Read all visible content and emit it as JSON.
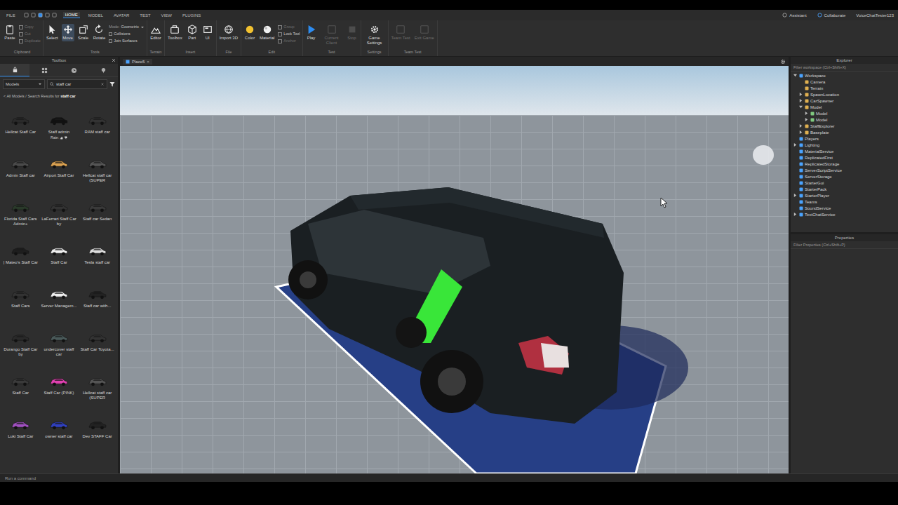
{
  "menu_bar": {
    "items": [
      {
        "label": "FILE",
        "selected": false
      },
      {
        "label": "HOME",
        "selected": true
      },
      {
        "label": "MODEL",
        "selected": false
      },
      {
        "label": "AVATAR",
        "selected": false
      },
      {
        "label": "TEST",
        "selected": false
      },
      {
        "label": "VIEW",
        "selected": false
      },
      {
        "label": "PLUGINS",
        "selected": false
      }
    ],
    "right": [
      {
        "label": "Assistant"
      },
      {
        "label": "Collaborate"
      },
      {
        "label": "VoiceChatTester123"
      }
    ]
  },
  "ribbon": {
    "groups": [
      {
        "label": "Clipboard",
        "buttons": [
          {
            "label": "Paste",
            "kind": "large",
            "disabled": false,
            "selected": false
          },
          {
            "label": "Copy",
            "kind": "small",
            "disabled": true,
            "selected": false
          },
          {
            "label": "Cut",
            "kind": "small",
            "disabled": true,
            "selected": false
          },
          {
            "label": "Duplicate",
            "kind": "small",
            "disabled": true,
            "selected": false
          }
        ]
      },
      {
        "label": "Tools",
        "buttons": [
          {
            "label": "Select",
            "kind": "large",
            "disabled": false,
            "selected": false
          },
          {
            "label": "Move",
            "kind": "large",
            "disabled": false,
            "selected": true
          },
          {
            "label": "Scale",
            "kind": "large",
            "disabled": false,
            "selected": false
          },
          {
            "label": "Rotate",
            "kind": "large",
            "disabled": false,
            "selected": false
          },
          {
            "label": "Mode:",
            "value": "Geometric",
            "kind": "dropdown",
            "disabled": false,
            "selected": false
          },
          {
            "label": "Collisions",
            "kind": "check",
            "checked": false,
            "disabled": false,
            "selected": false
          },
          {
            "label": "Join Surfaces",
            "kind": "check",
            "checked": false,
            "disabled": false,
            "selected": false
          }
        ]
      },
      {
        "label": "Terrain",
        "buttons": [
          {
            "label": "Editor",
            "kind": "large",
            "disabled": false,
            "selected": false
          }
        ]
      },
      {
        "label": "Insert",
        "buttons": [
          {
            "label": "Toolbox",
            "kind": "large",
            "disabled": false,
            "selected": false
          },
          {
            "label": "Part",
            "kind": "large",
            "disabled": false,
            "selected": false
          },
          {
            "label": "UI",
            "kind": "large",
            "disabled": false,
            "selected": false
          }
        ]
      },
      {
        "label": "File",
        "buttons": [
          {
            "label": "Import 3D",
            "kind": "large",
            "disabled": false,
            "selected": false
          }
        ]
      },
      {
        "label": "Edit",
        "buttons": [
          {
            "label": "Color",
            "kind": "large",
            "disabled": false,
            "selected": false
          },
          {
            "label": "Material",
            "kind": "large",
            "disabled": false,
            "selected": false
          },
          {
            "label": "Group",
            "kind": "small",
            "disabled": true,
            "selected": false
          },
          {
            "label": "Lock Tool",
            "kind": "small",
            "disabled": false,
            "selected": false
          },
          {
            "label": "Anchor",
            "kind": "small",
            "disabled": true,
            "selected": false
          }
        ]
      },
      {
        "label": "Test",
        "buttons": [
          {
            "label": "Play",
            "kind": "large",
            "disabled": false,
            "selected": false
          },
          {
            "label": "Current Client",
            "kind": "large",
            "disabled": true,
            "selected": false
          },
          {
            "label": "Stop",
            "kind": "large",
            "disabled": true,
            "selected": false
          }
        ]
      },
      {
        "label": "Settings",
        "buttons": [
          {
            "label": "Game Settings",
            "kind": "large",
            "disabled": false,
            "selected": false
          }
        ]
      },
      {
        "label": "Team Test",
        "buttons": [
          {
            "label": "Team Test",
            "kind": "large",
            "disabled": true,
            "selected": false
          },
          {
            "label": "Exit Game",
            "kind": "large",
            "disabled": true,
            "selected": false
          }
        ]
      }
    ]
  },
  "toolbox": {
    "title": "Toolbox",
    "tabs": [
      {
        "selected": true
      },
      {
        "selected": false
      },
      {
        "selected": false
      },
      {
        "selected": false
      }
    ],
    "category": "Models",
    "search": "staff car",
    "breadcrumb": "< All Models / Search Results for",
    "query": "staff car",
    "items": [
      {
        "label": "Hellcat Staff Car",
        "color": "#2a2a2a"
      },
      {
        "label": "Staff admin",
        "color": "#111111",
        "rating": "Rate:"
      },
      {
        "label": "RAM staff car",
        "color": "#333333"
      },
      {
        "label": "Admin Staff car",
        "color": "#4a4a4a"
      },
      {
        "label": "Airport Staff Car",
        "color": "#d9a050"
      },
      {
        "label": "Hellcat staff car (SUPER",
        "color": "#555555"
      },
      {
        "label": "Florida Staff Cars Admin+",
        "color": "#2a3a2a"
      },
      {
        "label": "LaFerrari Staff Car by",
        "color": "#333333"
      },
      {
        "label": "Staff car Sedan",
        "color": "#3a3a3a"
      },
      {
        "label": "| Mateo's Staff Car",
        "color": "#1e1e1e"
      },
      {
        "label": "Staff Car",
        "color": "#eeeeee"
      },
      {
        "label": "Tesla staff car",
        "color": "#dddddd"
      },
      {
        "label": "Staff Cars",
        "color": "#333333"
      },
      {
        "label": "Server Managem...",
        "color": "#eeeeee"
      },
      {
        "label": "Staff car with...",
        "color": "#222222"
      },
      {
        "label": "Durango Staff Car by",
        "color": "#2a2a2a"
      },
      {
        "label": "undercover staff car",
        "color": "#4a5a5a"
      },
      {
        "label": "Staff Car Toyota...",
        "color": "#333333"
      },
      {
        "label": "Staff Car",
        "color": "#3a3a3a"
      },
      {
        "label": "Staff Car (PINK)",
        "color": "#e040b0"
      },
      {
        "label": "Hellcat staff car (SUPER",
        "color": "#555555"
      },
      {
        "label": "Luki Staff Car",
        "color": "#a050c0"
      },
      {
        "label": "owner staff car",
        "color": "#3040c0"
      },
      {
        "label": "Dev STAFF Car",
        "color": "#222222"
      }
    ]
  },
  "viewport": {
    "tab": {
      "label": "Place5",
      "close": "×",
      "selected": true
    }
  },
  "explorer": {
    "title": "Explorer",
    "filter": "Filter workspace (Ctrl+Shift+X)",
    "tree": [
      {
        "label": "Workspace",
        "expandable": true,
        "expanded": true,
        "children": [
          {
            "label": "Camera",
            "expandable": false,
            "expanded": false
          },
          {
            "label": "Terrain",
            "expandable": false,
            "expanded": false
          },
          {
            "label": "SpawnLocation",
            "expandable": true,
            "expanded": false
          },
          {
            "label": "CarSpawner",
            "expandable": true,
            "expanded": false
          },
          {
            "label": "Model",
            "expandable": true,
            "expanded": true,
            "children": [
              {
                "label": "Model",
                "expandable": true,
                "expanded": false
              },
              {
                "label": "Model",
                "expandable": true,
                "expanded": false
              }
            ]
          },
          {
            "label": "StaffExplorer",
            "expandable": true,
            "expanded": false
          },
          {
            "label": "Baseplate",
            "expandable": true,
            "expanded": false
          }
        ]
      },
      {
        "label": "Players",
        "expandable": false,
        "expanded": false
      },
      {
        "label": "Lighting",
        "expandable": true,
        "expanded": false
      },
      {
        "label": "MaterialService",
        "expandable": false,
        "expanded": false
      },
      {
        "label": "ReplicatedFirst",
        "expandable": false,
        "expanded": false
      },
      {
        "label": "ReplicatedStorage",
        "expandable": false,
        "expanded": false
      },
      {
        "label": "ServerScriptService",
        "expandable": false,
        "expanded": false
      },
      {
        "label": "ServerStorage",
        "expandable": false,
        "expanded": false
      },
      {
        "label": "StarterGui",
        "expandable": false,
        "expanded": false
      },
      {
        "label": "StarterPack",
        "expandable": false,
        "expanded": false
      },
      {
        "label": "StarterPlayer",
        "expandable": true,
        "expanded": false
      },
      {
        "label": "Teams",
        "expandable": false,
        "expanded": false
      },
      {
        "label": "SoundService",
        "expandable": false,
        "expanded": false
      },
      {
        "label": "TextChatService",
        "expandable": true,
        "expanded": false
      }
    ]
  },
  "properties": {
    "title": "Properties",
    "filter": "Filter Properties (Ctrl+Shift+P)"
  },
  "command_bar": {
    "placeholder": "Run a command"
  }
}
